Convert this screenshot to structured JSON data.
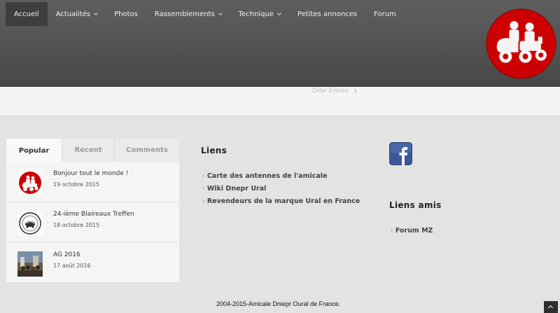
{
  "nav": {
    "items": [
      {
        "label": "Accueil",
        "dropdown": false
      },
      {
        "label": "Actualités",
        "dropdown": true
      },
      {
        "label": "Photos",
        "dropdown": false
      },
      {
        "label": "Rassemblements",
        "dropdown": true
      },
      {
        "label": "Technique",
        "dropdown": true
      },
      {
        "label": "Petites annonces",
        "dropdown": false
      },
      {
        "label": "Forum",
        "dropdown": false
      }
    ],
    "active_index": 0
  },
  "pagination": {
    "older_label": "Older Entries"
  },
  "widget": {
    "tabs": [
      {
        "label": "Popular"
      },
      {
        "label": "Recent"
      },
      {
        "label": "Comments"
      }
    ],
    "active_tab": 0,
    "posts": [
      {
        "title": "Bonjour tout le monde !",
        "date": "19 octobre 2015",
        "thumb": "red-sidecar-logo"
      },
      {
        "title": "24-ième Blaireaux Treffen",
        "date": "18 octobre 2015",
        "thumb": "badger-badge"
      },
      {
        "title": "AG 2016",
        "date": "17 août 2016",
        "thumb": "group-photo"
      }
    ]
  },
  "liens": {
    "title": "Liens",
    "items": [
      {
        "label": "Carte des antennes de l'amicale"
      },
      {
        "label": "Wiki Dnepr Ural"
      },
      {
        "label": "Revendeurs de la marque Ural en France"
      }
    ]
  },
  "liens_amis": {
    "title": "Liens amis",
    "items": [
      {
        "label": "Forum MZ"
      }
    ]
  },
  "social": {
    "icon": "facebook-icon",
    "color": "#3b5998"
  },
  "footer": {
    "text": "2004-2015-Amicale Dniepr Oural de France."
  },
  "colors": {
    "logo_red": "#cc0000",
    "header_dark": "#555555"
  }
}
